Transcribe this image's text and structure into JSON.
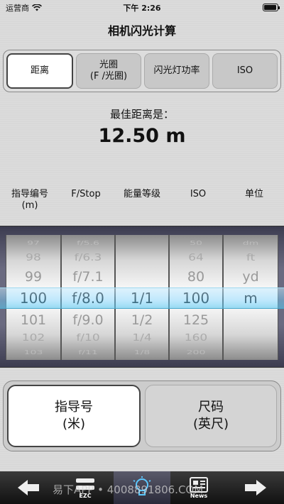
{
  "status": {
    "carrier": "运营商",
    "time": "下午 2:26"
  },
  "title": "相机闪光计算",
  "tabs": [
    {
      "label": "距离",
      "active": true
    },
    {
      "label": "光圈\n(F /光圈)",
      "active": false
    },
    {
      "label": "闪光灯功率",
      "active": false
    },
    {
      "label": "ISO",
      "active": false
    }
  ],
  "result": {
    "label": "最佳距离是：",
    "value": "12.50 m"
  },
  "columns": [
    "指导编号\n(m)",
    "F/Stop",
    "能量等级",
    "ISO",
    "单位"
  ],
  "picker": {
    "guide_number": [
      "97",
      "98",
      "99",
      "100",
      "101",
      "102",
      "103"
    ],
    "fstop": [
      "f/5.6",
      "f/6.3",
      "f/7.1",
      "f/8.0",
      "f/9.0",
      "f/10",
      "f/11"
    ],
    "power": [
      "",
      "",
      "",
      "1/1",
      "1/2",
      "1/4",
      "1/8"
    ],
    "iso": [
      "50",
      "64",
      "80",
      "100",
      "125",
      "160",
      "200"
    ],
    "unit": [
      "dm",
      "ft",
      "yd",
      "m",
      "",
      "",
      ""
    ]
  },
  "buttons": [
    {
      "label": "指导号\n(米)",
      "active": true
    },
    {
      "label": "尺码\n(英尺)",
      "active": false
    }
  ],
  "nav": {
    "ezc_label": "EZC",
    "news_label": "News"
  },
  "watermark": "易下APP • 4008891806.COM"
}
